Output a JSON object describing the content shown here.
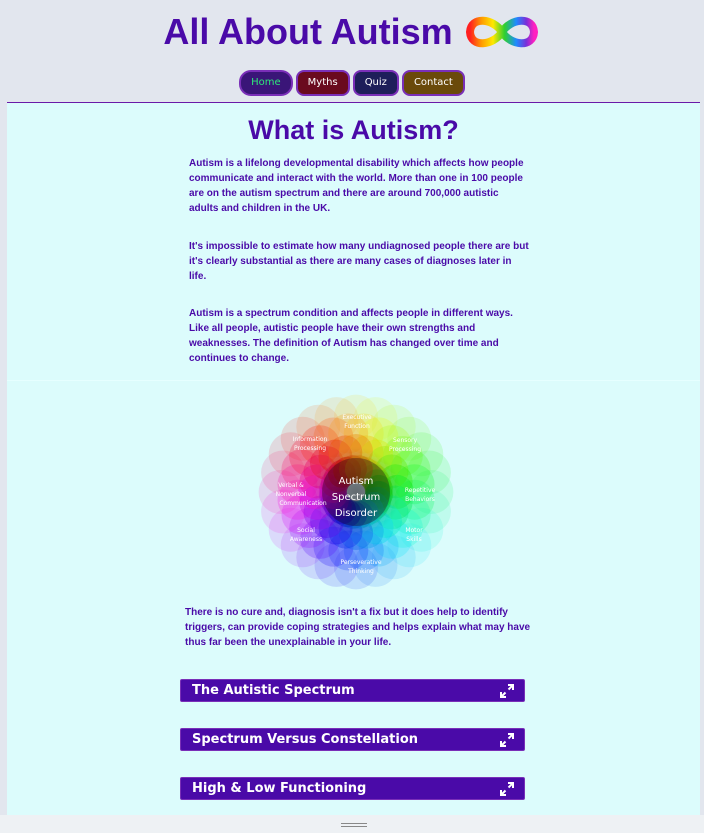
{
  "site": {
    "title": "All About Autism",
    "logo_icon": "infinity-rainbow-icon"
  },
  "nav": {
    "items": [
      {
        "label": "Home",
        "color": "#2ee87a"
      },
      {
        "label": "Myths"
      },
      {
        "label": "Quiz"
      },
      {
        "label": "Contact"
      }
    ]
  },
  "main": {
    "title": "What is Autism?",
    "paragraphs": [
      "Autism is a lifelong developmental disability which affects how people communicate and interact with the world. More than one in 100 people are on the autism spectrum and there are around 700,000 autistic adults and children in the UK.",
      "It's impossible to estimate how many undiagnosed people there are but it's clearly substantial as there are many cases of diagnoses later in life.",
      "Autism is a spectrum condition and affects people in different ways. Like all people, autistic people have their own strengths and weaknesses. The definition of Autism has changed over time and continues to change."
    ],
    "diagram": {
      "center_lines": [
        "Autism",
        "Spectrum",
        "Disorder"
      ],
      "petals": [
        {
          "l1": "Executive",
          "l2": "Function"
        },
        {
          "l1": "Sensory",
          "l2": "Processing"
        },
        {
          "l1": "Repetitive",
          "l2": "Behaviors"
        },
        {
          "l1": "Motor",
          "l2": "Skills"
        },
        {
          "l1": "Perseverative",
          "l2": "Thinking"
        },
        {
          "l1": "Social",
          "l2": "Awareness"
        },
        {
          "l1": "Verbal &",
          "l2": "Nonverbal",
          "l3": "Communication"
        },
        {
          "l1": "Information",
          "l2": "Processing"
        }
      ]
    },
    "after_text": "There is no cure and, diagnosis isn't a fix but it does help to identify triggers, can provide coping strategies and helps explain what may have thus far been the unexplainable in your life.",
    "accordions": [
      {
        "label": "The Autistic Spectrum",
        "icon": "expand-icon"
      },
      {
        "label": "Spectrum Versus Constellation",
        "icon": "expand-icon"
      },
      {
        "label": "High & Low Functioning",
        "icon": "expand-icon"
      }
    ]
  },
  "colors": {
    "accent": "#4a0aa8",
    "content_bg": "#dcfcfc",
    "header_bg": "#e2e6ee"
  }
}
